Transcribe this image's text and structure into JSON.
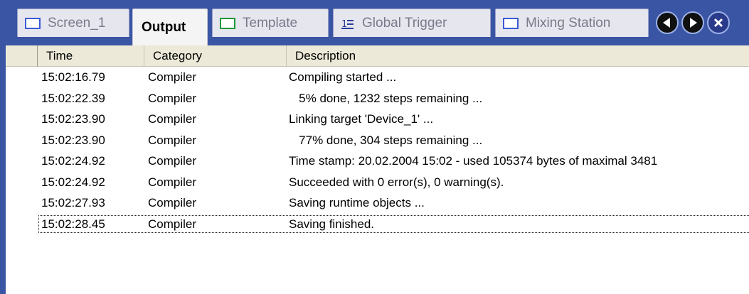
{
  "tabs": [
    {
      "label": "Screen_1",
      "icon": "screen-icon",
      "active": false
    },
    {
      "label": "Output",
      "icon": "",
      "active": true
    },
    {
      "label": "Template",
      "icon": "template-icon",
      "active": false
    },
    {
      "label": "Global Trigger",
      "icon": "trigger-list-icon",
      "active": false
    },
    {
      "label": "Mixing Station",
      "icon": "screen-icon",
      "active": false
    }
  ],
  "nav": {
    "prev_icon": "left-arrow-icon",
    "next_icon": "right-arrow-icon",
    "close_icon": "close-icon"
  },
  "columns": {
    "time": "Time",
    "category": "Category",
    "description": "Description"
  },
  "rows": [
    {
      "time": "15:02:16.79",
      "category": "Compiler",
      "description": "Compiling started ..."
    },
    {
      "time": "15:02:22.39",
      "category": "Compiler",
      "description": "   5% done, 1232 steps remaining ..."
    },
    {
      "time": "15:02:23.90",
      "category": "Compiler",
      "description": "Linking target 'Device_1' ..."
    },
    {
      "time": "15:02:23.90",
      "category": "Compiler",
      "description": "   77% done, 304 steps remaining ..."
    },
    {
      "time": "15:02:24.92",
      "category": "Compiler",
      "description": "Time stamp: 20.02.2004 15:02 - used 105374 bytes of maximal 3481"
    },
    {
      "time": "15:02:24.92",
      "category": "Compiler",
      "description": "Succeeded with 0 error(s), 0 warning(s)."
    },
    {
      "time": "15:02:27.93",
      "category": "Compiler",
      "description": "Saving runtime objects ..."
    },
    {
      "time": "15:02:28.45",
      "category": "Compiler",
      "description": "Saving finished."
    }
  ],
  "colors": {
    "tabbar_bg": "#3a55a4",
    "header_bg": "#ece9d8"
  }
}
